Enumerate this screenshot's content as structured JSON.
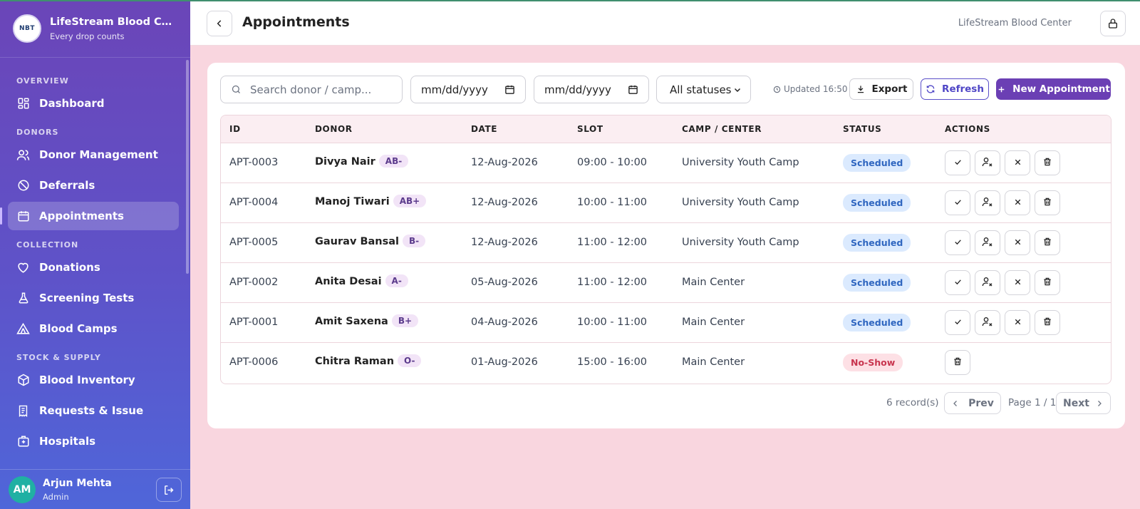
{
  "app": {
    "brand_title": "LifeStream Blood Center",
    "brand_subtitle": "Every drop counts",
    "logo_text": "NBT"
  },
  "sidebar": {
    "sections": [
      {
        "label": "OVERVIEW",
        "items": [
          {
            "label": "Dashboard",
            "icon": "dashboard-icon"
          }
        ]
      },
      {
        "label": "DONORS",
        "items": [
          {
            "label": "Donor Management",
            "icon": "users-icon"
          },
          {
            "label": "Deferrals",
            "icon": "ban-icon"
          },
          {
            "label": "Appointments",
            "icon": "calendar-icon",
            "active": true
          }
        ]
      },
      {
        "label": "COLLECTION",
        "items": [
          {
            "label": "Donations",
            "icon": "heart-icon"
          },
          {
            "label": "Screening Tests",
            "icon": "flask-icon"
          },
          {
            "label": "Blood Camps",
            "icon": "tent-icon"
          }
        ]
      },
      {
        "label": "STOCK & SUPPLY",
        "items": [
          {
            "label": "Blood Inventory",
            "icon": "box-icon"
          },
          {
            "label": "Requests & Issue",
            "icon": "receipt-icon"
          },
          {
            "label": "Hospitals",
            "icon": "hospital-icon"
          }
        ]
      }
    ],
    "user": {
      "initials": "AM",
      "name": "Arjun Mehta",
      "role": "Admin"
    }
  },
  "header": {
    "title": "Appointments",
    "center_name": "LifeStream Blood Center"
  },
  "toolbar": {
    "search_placeholder": "Search donor / camp...",
    "date_from": "mm/dd/yyyy",
    "date_to": "mm/dd/yyyy",
    "status_filter": "All statuses",
    "updated": "Updated 16:50",
    "export_label": "Export",
    "refresh_label": "Refresh",
    "new_label": "New Appointment"
  },
  "table": {
    "columns": [
      "ID",
      "DONOR",
      "DATE",
      "SLOT",
      "CAMP / CENTER",
      "STATUS",
      "ACTIONS"
    ],
    "rows": [
      {
        "id": "APT-0003",
        "donor": "Divya Nair",
        "blood": "AB-",
        "date": "12-Aug-2026",
        "slot": "09:00 - 10:00",
        "camp": "University Youth Camp",
        "status": "Scheduled"
      },
      {
        "id": "APT-0004",
        "donor": "Manoj Tiwari",
        "blood": "AB+",
        "date": "12-Aug-2026",
        "slot": "10:00 - 11:00",
        "camp": "University Youth Camp",
        "status": "Scheduled"
      },
      {
        "id": "APT-0005",
        "donor": "Gaurav Bansal",
        "blood": "B-",
        "date": "12-Aug-2026",
        "slot": "11:00 - 12:00",
        "camp": "University Youth Camp",
        "status": "Scheduled"
      },
      {
        "id": "APT-0002",
        "donor": "Anita Desai",
        "blood": "A-",
        "date": "05-Aug-2026",
        "slot": "11:00 - 12:00",
        "camp": "Main Center",
        "status": "Scheduled"
      },
      {
        "id": "APT-0001",
        "donor": "Amit Saxena",
        "blood": "B+",
        "date": "04-Aug-2026",
        "slot": "10:00 - 11:00",
        "camp": "Main Center",
        "status": "Scheduled"
      },
      {
        "id": "APT-0006",
        "donor": "Chitra Raman",
        "blood": "O-",
        "date": "01-Aug-2026",
        "slot": "15:00 - 16:00",
        "camp": "Main Center",
        "status": "No-Show"
      }
    ]
  },
  "pagination": {
    "records": "6 record(s)",
    "prev_label": "Prev",
    "page_label": "Page 1 / 1",
    "next_label": "Next"
  },
  "colors": {
    "accent": "#6b3fb4",
    "scheduled": "#2f66c0",
    "no_show": "#c8354f",
    "background": "#f9d6df"
  }
}
